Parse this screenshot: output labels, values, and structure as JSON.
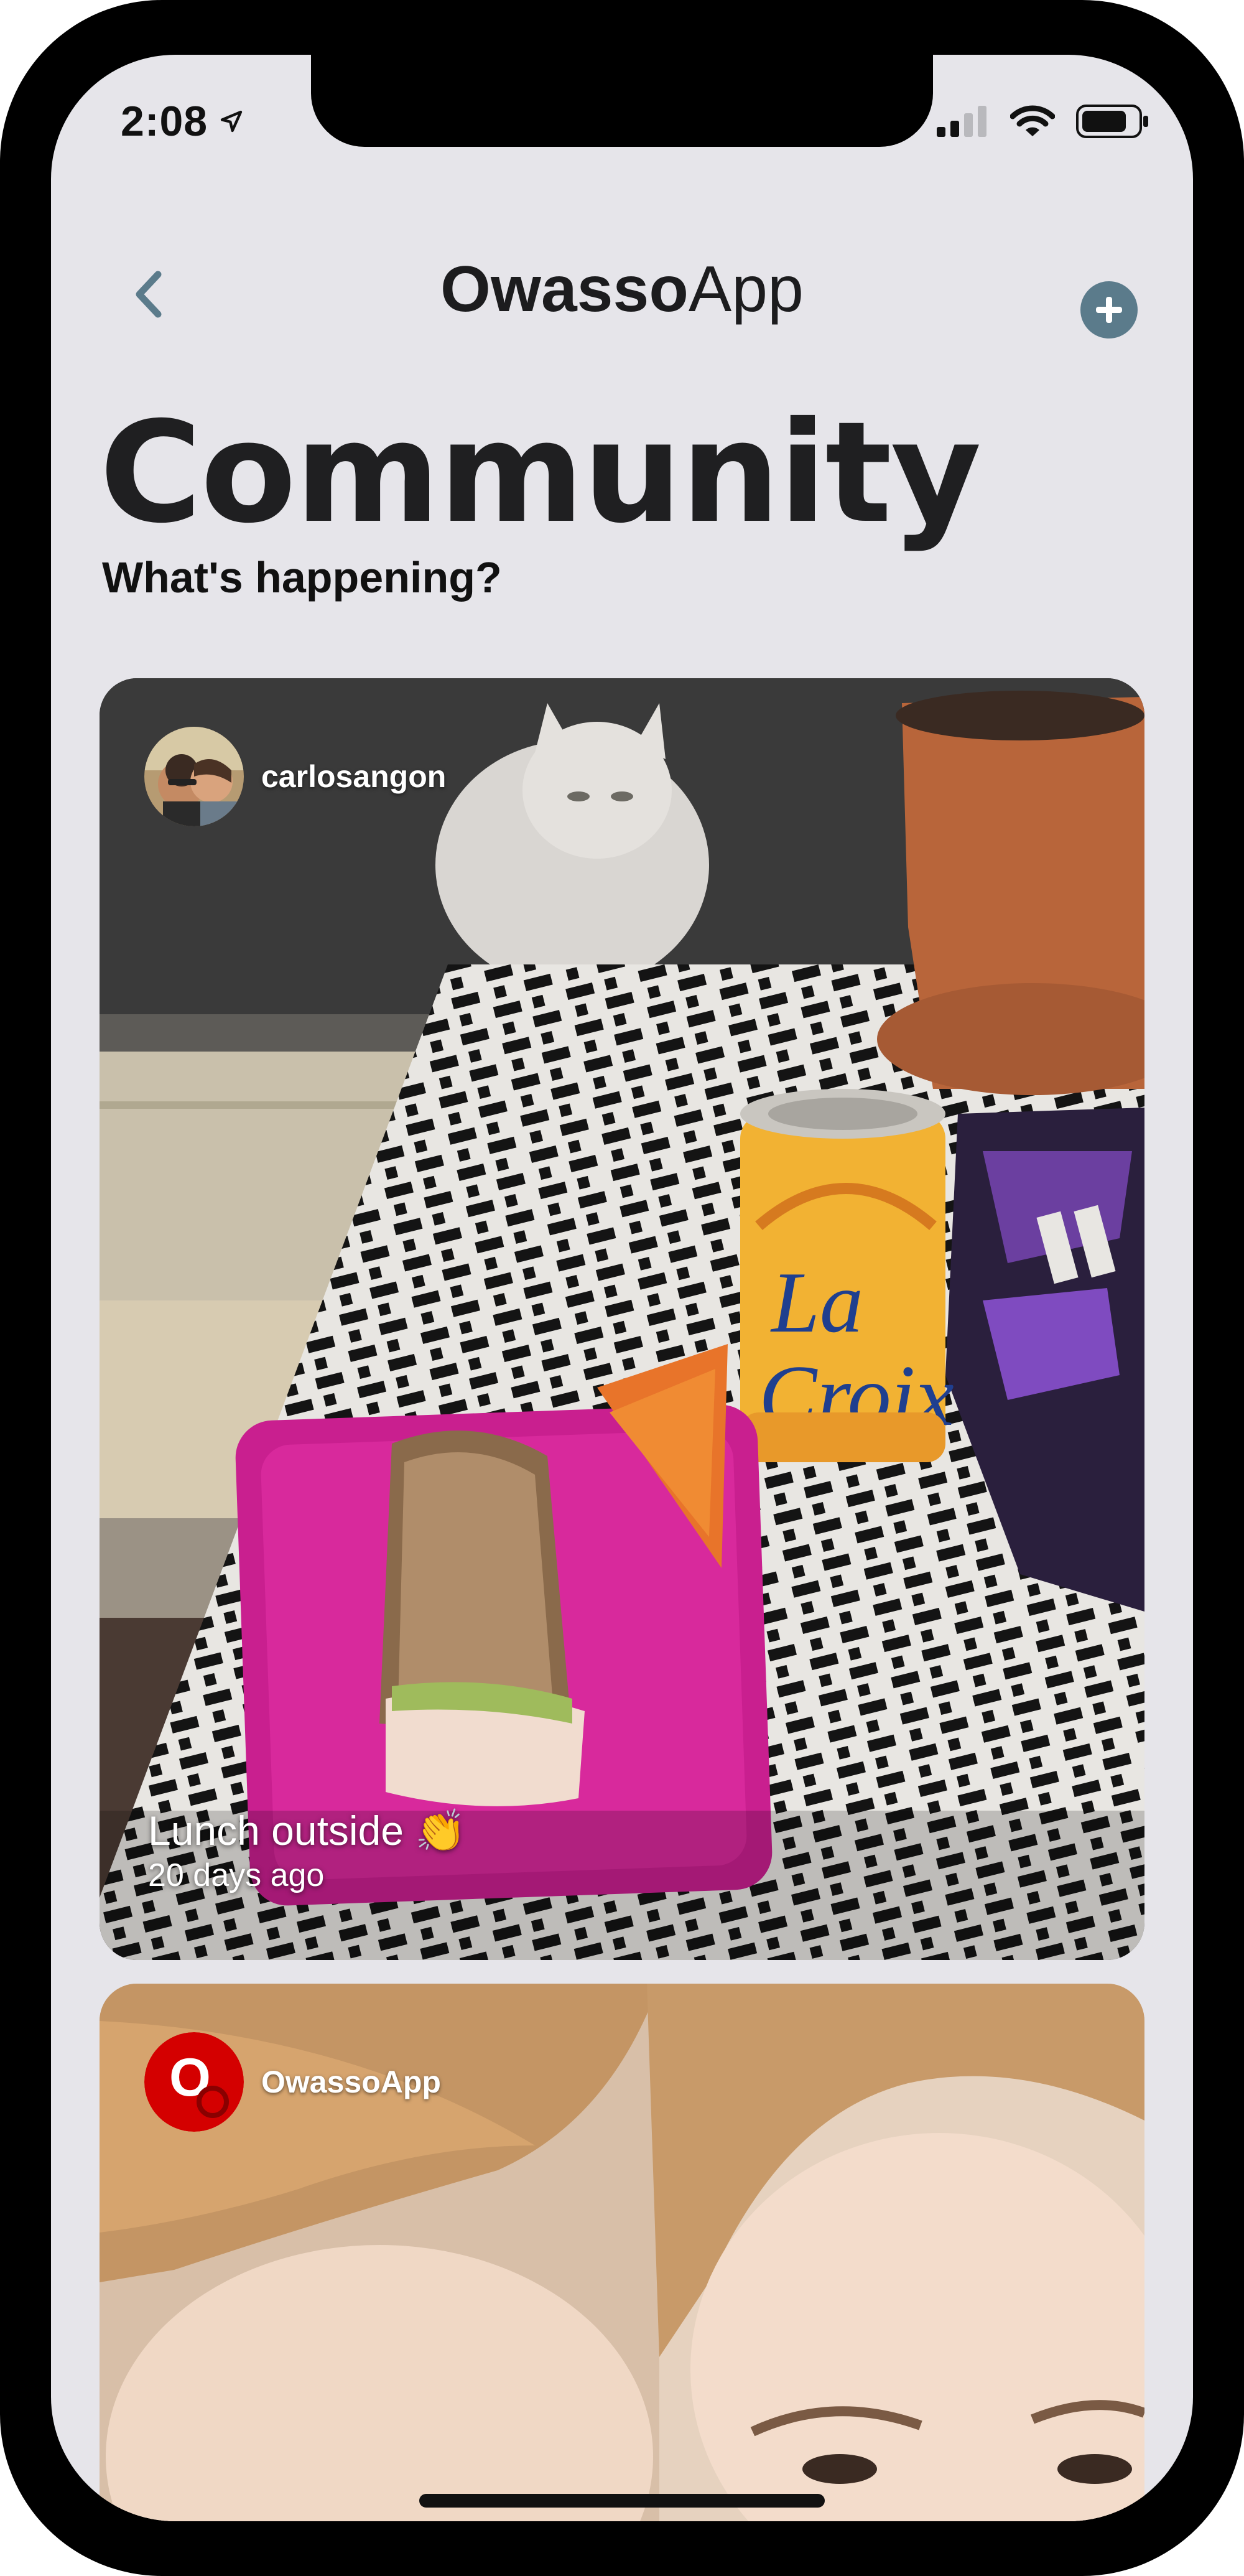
{
  "status_bar": {
    "time": "2:08",
    "location_icon": "location-arrow-icon",
    "signal_icon": "cellular-signal-icon",
    "wifi_icon": "wifi-icon",
    "battery_icon": "battery-icon"
  },
  "nav": {
    "back_icon": "chevron-left-icon",
    "title_bold": "Owasso",
    "title_light": "App",
    "add_icon": "plus-circle-icon"
  },
  "page": {
    "title": "Community",
    "subtitle": "What's happening?"
  },
  "posts": [
    {
      "author": "carlosangon",
      "caption": "Lunch outside 👏",
      "time_ago": "20 days ago"
    },
    {
      "author": "OwassoApp"
    }
  ],
  "colors": {
    "background": "#e6e5ea",
    "accent": "#5b7b8b",
    "owasso_red": "#d40000"
  }
}
